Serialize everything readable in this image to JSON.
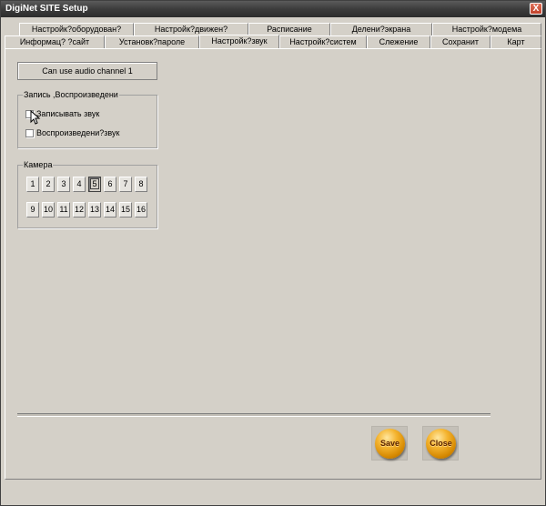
{
  "window": {
    "title": "DigiNet SITE Setup",
    "close_glyph": "X"
  },
  "tabs": {
    "top_row": [
      "Настройк?оборудован?",
      "Настройк?движен?",
      "Расписание",
      "Делени?экрана",
      "Настройк?модема"
    ],
    "bottom_row": [
      "Информац? ?сайт",
      "Установк?пароле",
      "Настройк?звук",
      "Настройк?систем",
      "Слежение",
      "Сохранит",
      "Карт"
    ],
    "active": "Настройк?звук"
  },
  "audio": {
    "status": "Can use audio channel 1",
    "group_title": "Запись ,Воспроизведени",
    "record_label": "Записывать звук",
    "play_label": "Воспроизведени?звук",
    "record_checked": false,
    "play_checked": false
  },
  "camera": {
    "group_title": "Камера",
    "row1": [
      "1",
      "2",
      "3",
      "4",
      "5",
      "6",
      "7",
      "8"
    ],
    "row2": [
      "9",
      "10",
      "11",
      "12",
      "13",
      "14",
      "15",
      "16"
    ],
    "selected": "5"
  },
  "actions": {
    "save": "Save",
    "close": "Close"
  }
}
